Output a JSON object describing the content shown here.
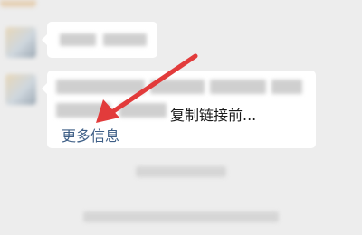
{
  "chat": {
    "message_2": {
      "visible_tail": "复制链接前...",
      "more_info_link": "更多信息"
    }
  },
  "annotation": {
    "arrow_color": "#e23b3b",
    "arrow_target": "more-info-link"
  },
  "colors": {
    "background": "#ededed",
    "bubble": "#ffffff",
    "link": "#3d5e86"
  }
}
